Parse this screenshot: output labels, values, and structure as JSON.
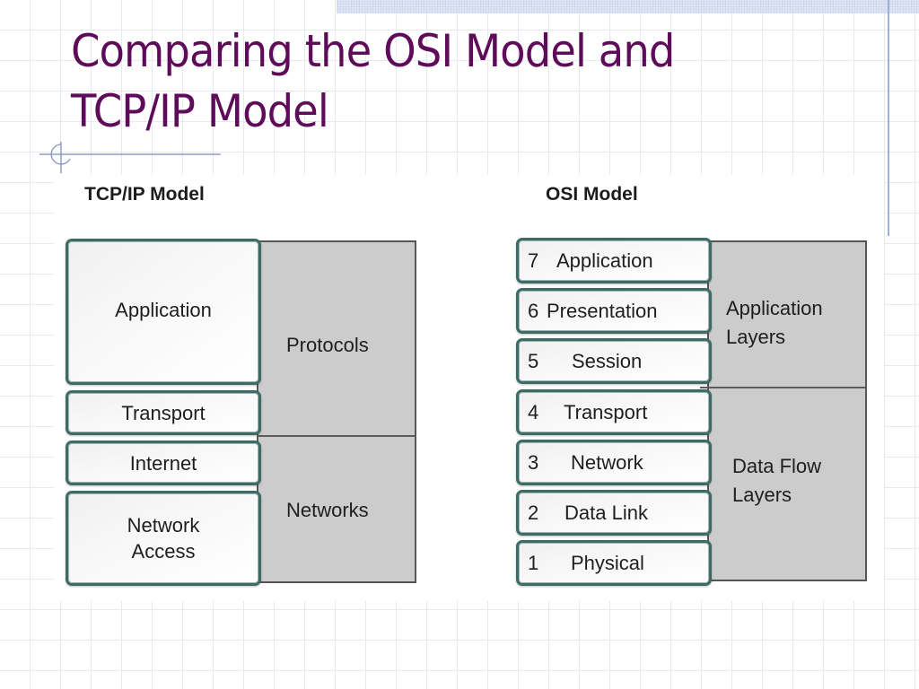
{
  "slide": {
    "title_lines": [
      "Comparing the OSI Model and",
      "TCP/IP Model"
    ],
    "colors": {
      "title": "#5e0b5a",
      "layer_border": "#3f6b66",
      "group_fill": "#cccccc",
      "accent_rule": "#9fb2d3"
    }
  },
  "tcpip": {
    "heading": "TCP/IP Model",
    "layers": [
      {
        "name": "Application"
      },
      {
        "name": "Transport"
      },
      {
        "name": "Internet"
      },
      {
        "name": "Network Access",
        "lines": [
          "Network",
          "Access"
        ]
      }
    ],
    "groups": [
      {
        "label": "Protocols",
        "covers": [
          "Application",
          "Transport"
        ]
      },
      {
        "label": "Networks",
        "covers": [
          "Internet",
          "Network Access"
        ]
      }
    ]
  },
  "osi": {
    "heading": "OSI Model",
    "layers": [
      {
        "number": "7",
        "name": "Application"
      },
      {
        "number": "6",
        "name": "Presentation"
      },
      {
        "number": "5",
        "name": "Session"
      },
      {
        "number": "4",
        "name": "Transport"
      },
      {
        "number": "3",
        "name": "Network"
      },
      {
        "number": "2",
        "name": "Data Link"
      },
      {
        "number": "1",
        "name": "Physical"
      }
    ],
    "groups": [
      {
        "label_lines": [
          "Application",
          "Layers"
        ],
        "covers": [
          "7",
          "6",
          "5"
        ]
      },
      {
        "label_lines": [
          "Data Flow",
          "Layers"
        ],
        "covers": [
          "4",
          "3",
          "2",
          "1"
        ]
      }
    ]
  }
}
